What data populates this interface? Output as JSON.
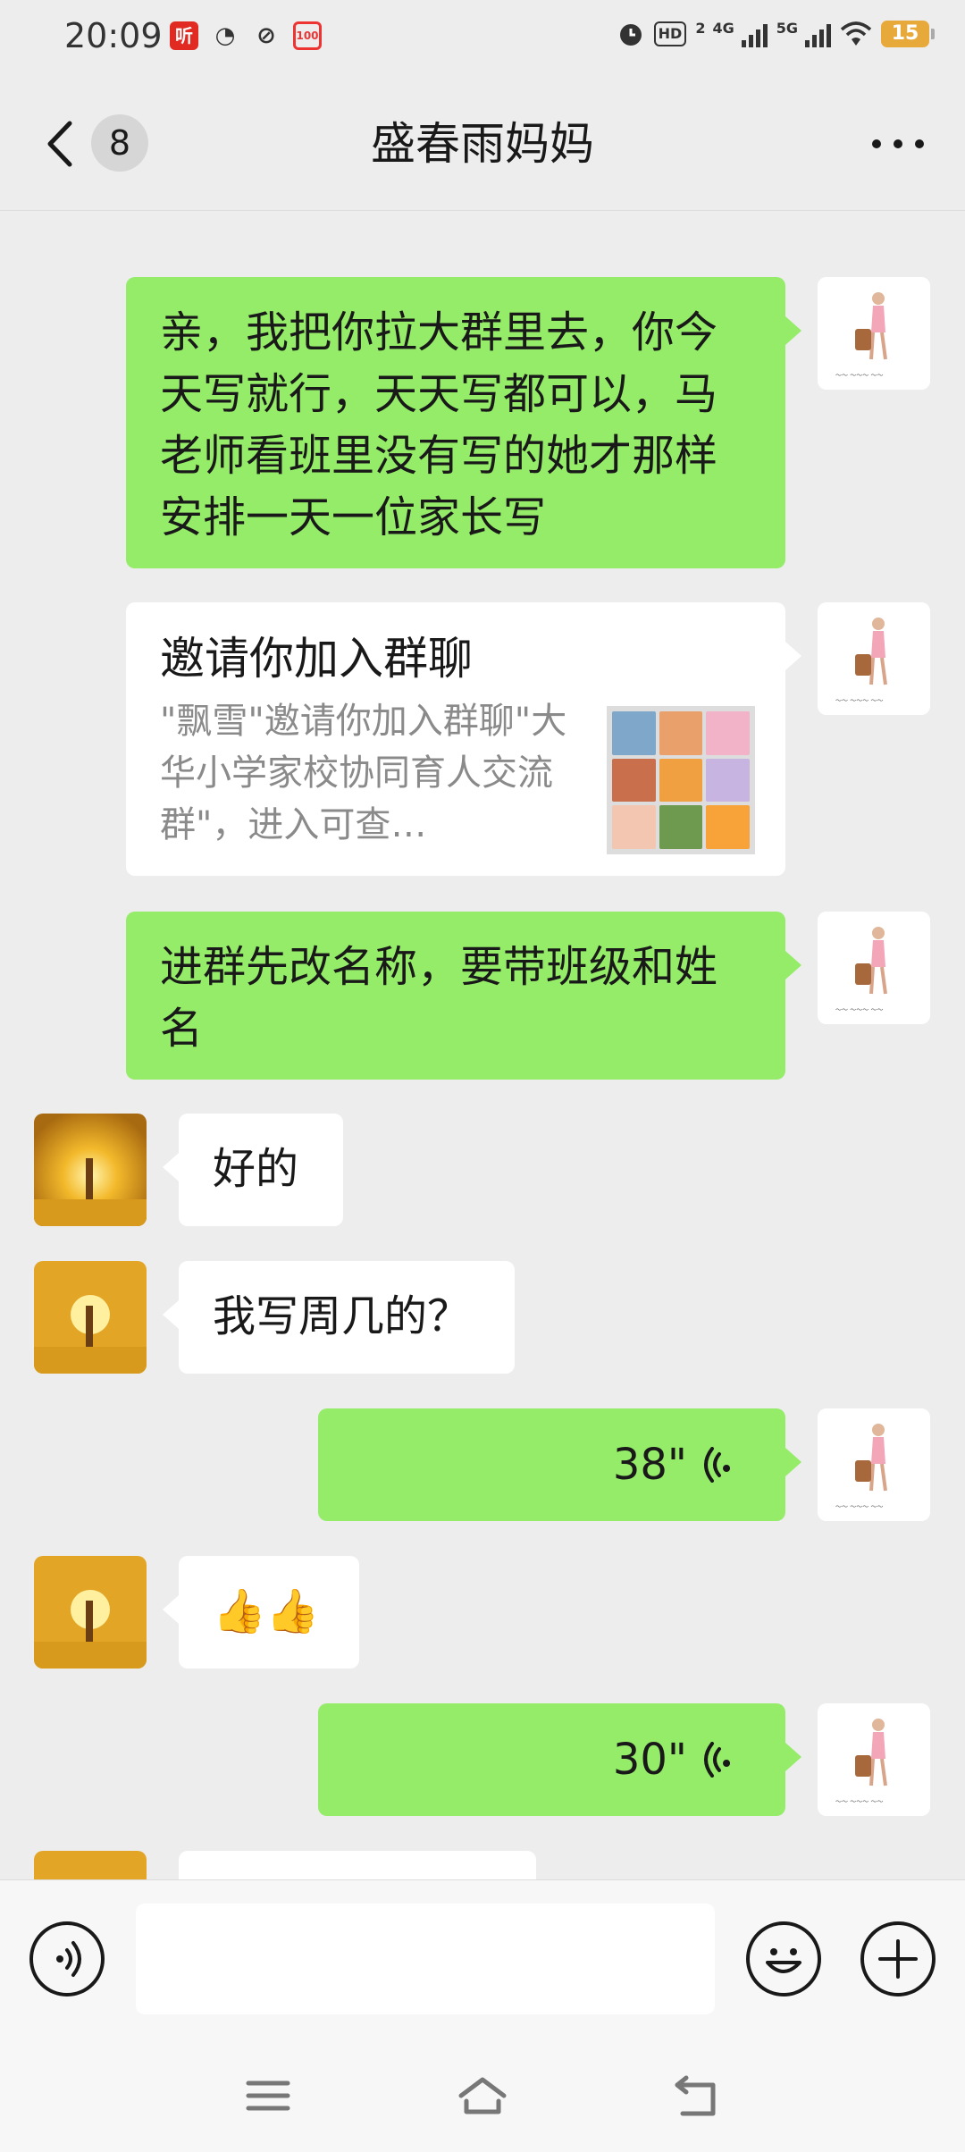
{
  "status_bar": {
    "time": "20:09",
    "app_icons": [
      {
        "name": "ting-app-icon",
        "glyph": "听"
      },
      {
        "name": "wechat-icon",
        "glyph": "◔"
      },
      {
        "name": "link-icon",
        "glyph": "⊘"
      },
      {
        "name": "calendar-icon",
        "glyph": "100"
      }
    ],
    "hd_label": "HD",
    "hd_sub": "2",
    "signal1_label": "4G",
    "signal2_label": "5G",
    "battery": "15"
  },
  "nav": {
    "unread_count": "8",
    "title": "盛春雨妈妈"
  },
  "messages": [
    {
      "from": "me",
      "type": "text",
      "text": "亲，我把你拉大群里去，你今天写就行，天天写都可以，马老师看班里没有写的她才那样安排一天一位家长写"
    },
    {
      "from": "me",
      "type": "card",
      "title": "邀请你加入群聊",
      "desc": "\"飘雪\"邀请你加入群聊\"大华小学家校协同育人交流群\"，进入可查…"
    },
    {
      "from": "me",
      "type": "text",
      "text": "进群先改名称，要带班级和姓名"
    },
    {
      "from": "them",
      "type": "text",
      "text": "好的"
    },
    {
      "from": "them",
      "type": "text",
      "text": "我写周几的？"
    },
    {
      "from": "me",
      "type": "voice",
      "duration": "38\""
    },
    {
      "from": "them",
      "type": "emoji",
      "emojis": "👍👍"
    },
    {
      "from": "me",
      "type": "voice",
      "duration": "30\""
    }
  ],
  "input": {
    "placeholder": ""
  },
  "colors": {
    "my_bubble": "#95ec69",
    "their_bubble": "#ffffff",
    "background": "#ededed"
  }
}
